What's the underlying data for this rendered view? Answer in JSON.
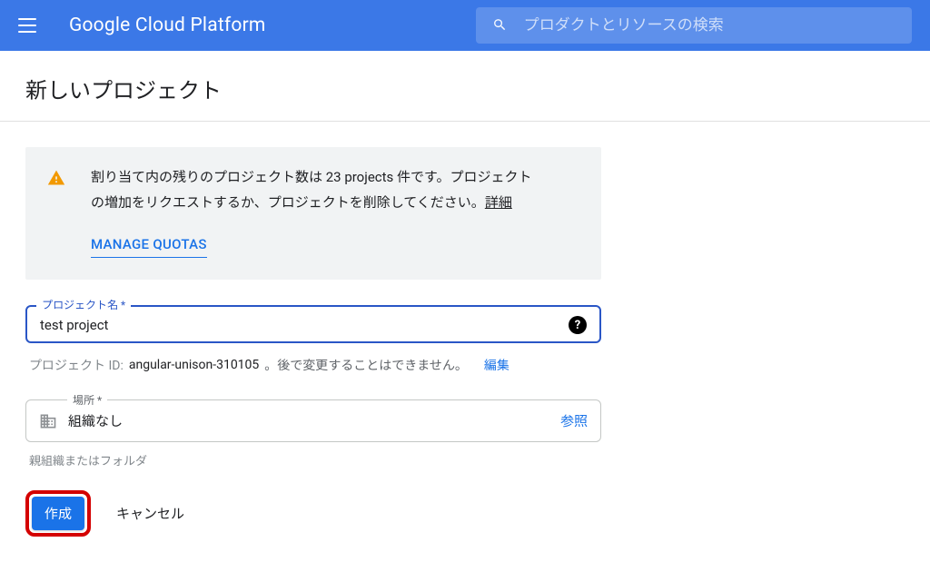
{
  "header": {
    "brand": "Google Cloud Platform",
    "search_placeholder": "プロダクトとリソースの検索"
  },
  "page": {
    "title": "新しいプロジェクト"
  },
  "alert": {
    "line1_pre": "割り当て内の残りのプロジェクト数は ",
    "line1_count": "23 projects",
    "line1_post": " 件です。プロジェクト",
    "line2_pre": "の増加をリクエストするか、プロジェクトを削除してください。",
    "details_label": "詳細",
    "manage_quotas": "MANAGE QUOTAS"
  },
  "form": {
    "project_name_label": "プロジェクト名 *",
    "project_name_value": "test project",
    "project_id_label": "プロジェクト ID:",
    "project_id_value": "angular-unison-310105",
    "project_id_note": "。後で変更することはできません。",
    "edit_label": "編集",
    "location_label": "場所 *",
    "location_value": "組織なし",
    "browse_label": "参照",
    "location_helper": "親組織またはフォルダ"
  },
  "actions": {
    "create": "作成",
    "cancel": "キャンセル"
  }
}
